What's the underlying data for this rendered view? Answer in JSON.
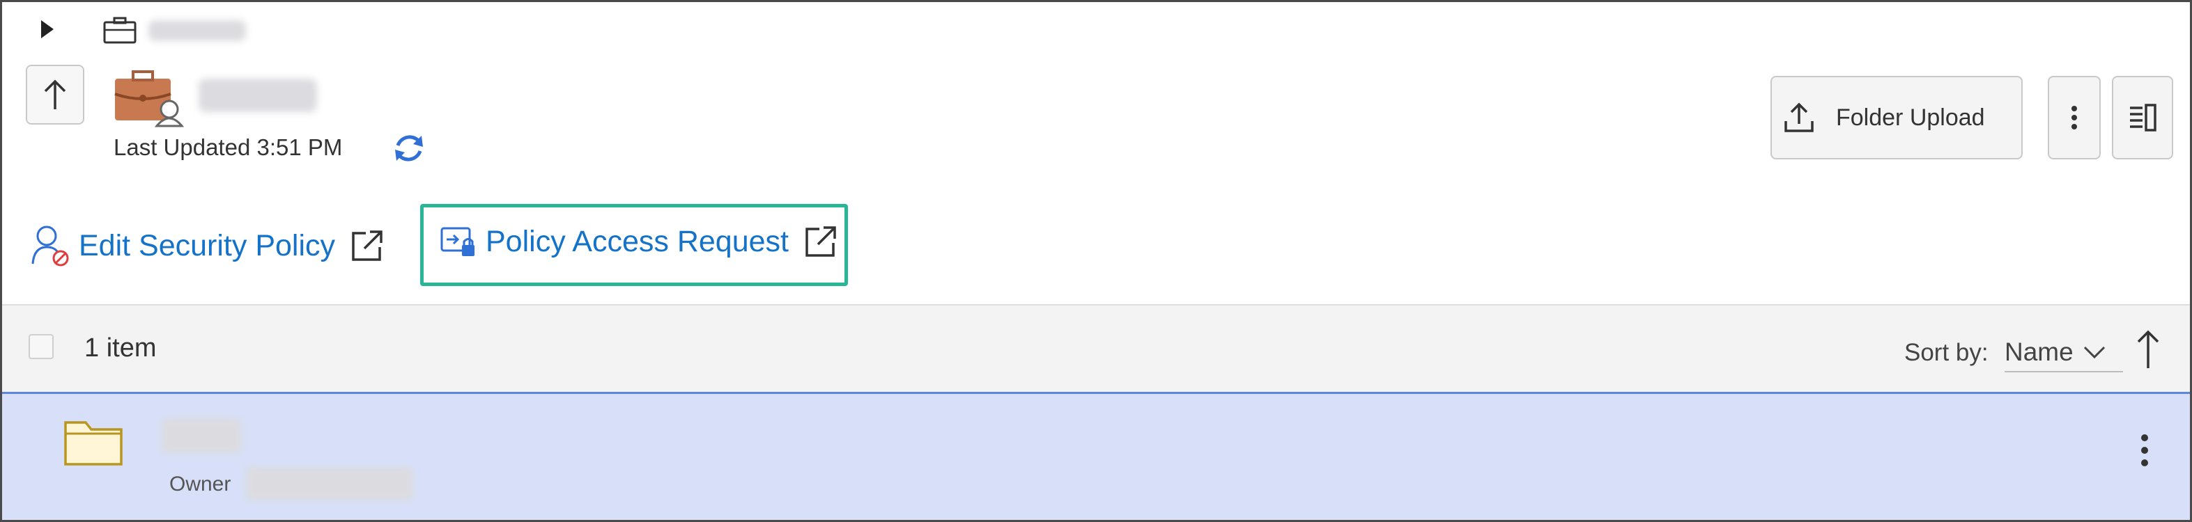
{
  "header": {
    "last_updated_label": "Last Updated 3:51 PM"
  },
  "toolbar": {
    "folder_upload_label": "Folder Upload"
  },
  "links": {
    "edit_security_policy": "Edit Security Policy",
    "policy_access_request": "Policy Access Request"
  },
  "list": {
    "item_count": "1 item",
    "sort_label": "Sort by:",
    "sort_value": "Name",
    "rows": [
      {
        "owner_label": "Owner"
      }
    ]
  },
  "colors": {
    "link": "#1572c9",
    "highlight_border": "#27b796",
    "selected_row_bg": "#d7e0f8",
    "selected_row_border": "#5c86e3",
    "folder_icon": "#b8961f"
  },
  "icons": {
    "expand": "triangle-right-icon",
    "case": "briefcase-outline-icon",
    "up": "arrow-up-icon",
    "workspace": "briefcase-user-icon",
    "sync": "sync-icon",
    "upload": "upload-icon",
    "more": "vertical-dots-icon",
    "panel": "details-panel-icon",
    "security": "user-blocked-icon",
    "access": "policy-lock-icon",
    "external": "external-link-icon",
    "folder": "folder-icon",
    "sort": "chevron-down-icon",
    "sort_direction": "arrow-up-icon"
  }
}
